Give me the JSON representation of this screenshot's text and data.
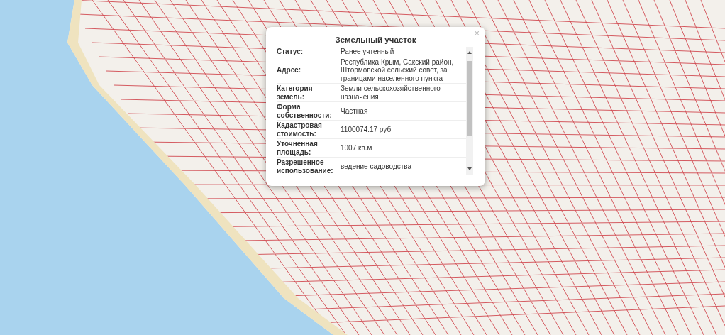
{
  "popup": {
    "title": "Земельный участок",
    "close": "×",
    "rows": [
      {
        "label": "Статус:",
        "value": "Ранее учтенный"
      },
      {
        "label": "Адрес:",
        "value": "Республика Крым, Сакский район, Штормовской сельский совет, за границами населенного пункта"
      },
      {
        "label": "Категория земель:",
        "value": "Земли сельскохозяйственного назначения"
      },
      {
        "label": "Форма собственности:",
        "value": "Частная"
      },
      {
        "label": "Кадастровая стоимость:",
        "value": "1100074.17 руб"
      },
      {
        "label": "Уточненная площадь:",
        "value": "1007 кв.м"
      },
      {
        "label": "Разрешенное использование:",
        "value": "ведение садоводства"
      }
    ]
  }
}
